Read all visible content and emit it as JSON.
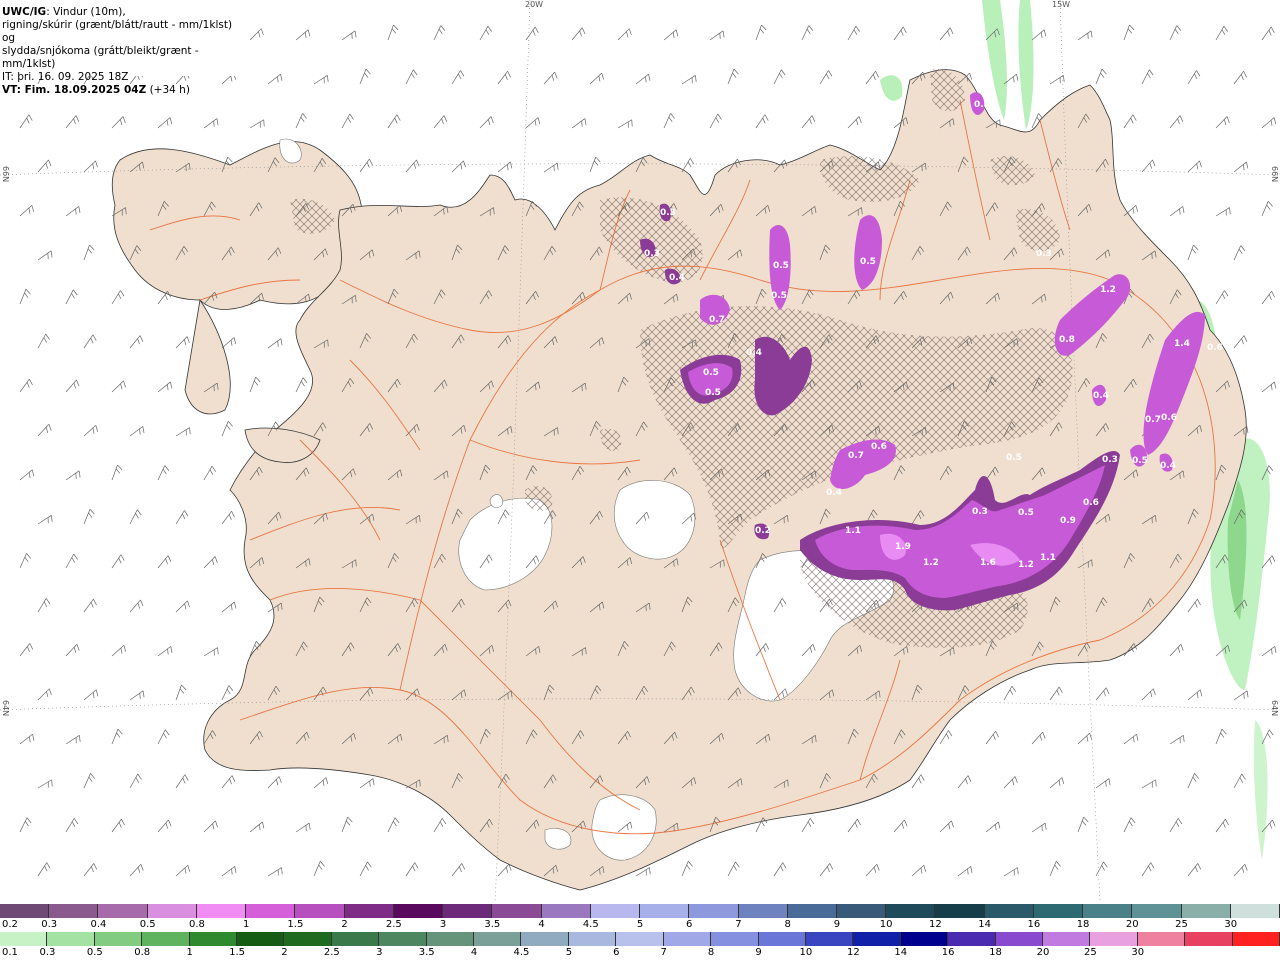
{
  "header": {
    "model": "UWC/IG",
    "title_rest": ": Vindur (10m),",
    "line2": "rigning/skúrir (grænt/blátt/rautt - mm/1klst) og",
    "line3": "slydda/snjókoma (grátt/bleikt/grænt - mm/1klst)",
    "it": "IT: þri. 16. 09. 2025 18Z",
    "vt_label": "VT: Fim. 18.09.2025 04Z",
    "lead": "(+34 h)"
  },
  "graticule": {
    "top_20w": "20W",
    "top_15w": "15W",
    "left_66n": "66N",
    "right_66n": "66N",
    "left_64n": "64N",
    "right_64n": "64N"
  },
  "colors": {
    "land": "#f0dfce",
    "ocean": "#ffffff",
    "roads": "#e8632a",
    "glacier": "#ffffff",
    "snow_main": "#c75ad6",
    "snow_dark": "#8a3c96",
    "snow_light": "#e88cf4",
    "rain_light": "#b9f0b9",
    "rain_mid": "#8ed88e"
  },
  "precip_labels": [
    {
      "id": "l1",
      "text": "0.5"
    },
    {
      "id": "l2",
      "text": "0.3"
    },
    {
      "id": "l3",
      "text": "0.4"
    },
    {
      "id": "l4",
      "text": "0.3"
    },
    {
      "id": "l5",
      "text": "0.5"
    },
    {
      "id": "l6",
      "text": "0.5"
    },
    {
      "id": "l7",
      "text": "0.3"
    },
    {
      "id": "l8",
      "text": "1.2"
    },
    {
      "id": "l9",
      "text": "0.7"
    },
    {
      "id": "l10",
      "text": "0.4"
    },
    {
      "id": "l11",
      "text": "0.5"
    },
    {
      "id": "l12",
      "text": "0.5"
    },
    {
      "id": "l13",
      "text": "0.5"
    },
    {
      "id": "l14",
      "text": "0.8"
    },
    {
      "id": "l15",
      "text": "1.4"
    },
    {
      "id": "l16",
      "text": "0.6"
    },
    {
      "id": "l17",
      "text": "0.4"
    },
    {
      "id": "l18",
      "text": "0.7"
    },
    {
      "id": "l19",
      "text": "0.6"
    },
    {
      "id": "l20",
      "text": "0.7"
    },
    {
      "id": "l21",
      "text": "0.6"
    },
    {
      "id": "l22",
      "text": "0.4"
    },
    {
      "id": "l23",
      "text": "0.3"
    },
    {
      "id": "l24",
      "text": "0.5"
    },
    {
      "id": "l25",
      "text": "0.4"
    },
    {
      "id": "l26",
      "text": "0.2"
    },
    {
      "id": "l27",
      "text": "1.1"
    },
    {
      "id": "l28",
      "text": "1.9"
    },
    {
      "id": "l29",
      "text": "1.2"
    },
    {
      "id": "l30",
      "text": "0.3"
    },
    {
      "id": "l31",
      "text": "1.6"
    },
    {
      "id": "l32",
      "text": "0.5"
    },
    {
      "id": "l33",
      "text": "1.2"
    },
    {
      "id": "l34",
      "text": "1.1"
    },
    {
      "id": "l35",
      "text": "0.9"
    },
    {
      "id": "l36",
      "text": "0.6"
    },
    {
      "id": "l37",
      "text": "0.5"
    }
  ],
  "legend": {
    "snow_ticks": [
      "0.2",
      "0.3",
      "0.4",
      "0.5",
      "0.8",
      "1",
      "1.5",
      "2",
      "2.5",
      "3",
      "3.5",
      "4",
      "4.5",
      "5",
      "6",
      "7",
      "8",
      "9",
      "10",
      "12",
      "14",
      "16",
      "18",
      "20",
      "25",
      "30"
    ],
    "snow_colors": [
      "#6e4a75",
      "#8a5a8e",
      "#a76aaa",
      "#d98ee0",
      "#f08cf4",
      "#d55fd8",
      "#b84fbf",
      "#7e2c86",
      "#5a0a5e",
      "#6e2a7a",
      "#8a4a95",
      "#9a78c0",
      "#b8b8ee",
      "#a8b0ea",
      "#8e98dc",
      "#6e82c0",
      "#4a6a98",
      "#3a5a7a",
      "#1e4a5a",
      "#163e4a",
      "#2a5a6a",
      "#2e6a72",
      "#4a8088",
      "#5e9296",
      "#8aaea8",
      "#cfe0dc"
    ],
    "rain_ticks": [
      "0.1",
      "0.3",
      "0.5",
      "0.8",
      "1",
      "1.5",
      "2",
      "2.5",
      "3",
      "3.5",
      "4",
      "4.5",
      "5",
      "6",
      "7",
      "8",
      "9",
      "10",
      "12",
      "14",
      "16",
      "18",
      "20",
      "25",
      "30"
    ],
    "rain_colors": [
      "#c6f2c6",
      "#a4e2a4",
      "#82cc82",
      "#5fb35f",
      "#2f8a2f",
      "#145c14",
      "#1e6a1e",
      "#3a7a4a",
      "#4e8660",
      "#66947a",
      "#7aa098",
      "#90aac0",
      "#a8b8de",
      "#b8c0ec",
      "#a0a8e8",
      "#8690e0",
      "#6a76d8",
      "#3a46c0",
      "#1020a8",
      "#00008e",
      "#4a2ab0",
      "#8a4ad0",
      "#c07ae0",
      "#e8a0e0",
      "#f080a0",
      "#e84060",
      "#ff2020"
    ]
  }
}
